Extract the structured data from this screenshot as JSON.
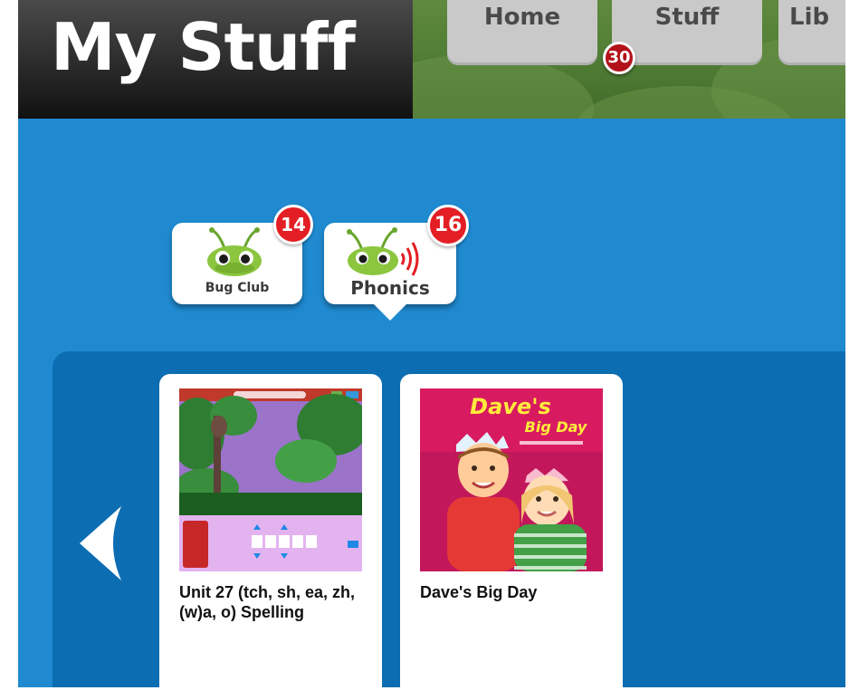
{
  "header": {
    "title": "My Stuff",
    "nav": [
      {
        "label": "Home"
      },
      {
        "label": "Stuff"
      },
      {
        "label": "Lib"
      }
    ],
    "stuff_badge": "30"
  },
  "categories": [
    {
      "label": "Bug Club",
      "badge": "14"
    },
    {
      "label": "Phonics",
      "badge": "16"
    }
  ],
  "items": [
    {
      "title": "Unit 27 (tch, sh, ea, zh, (w)a, o) Spelling"
    },
    {
      "title": "Dave's Big Day",
      "cover_title_line1": "Dave's",
      "cover_title_line2": "Big Day"
    }
  ],
  "colors": {
    "blue_background": "#1f8ad0",
    "panel_blue": "#0c6db3",
    "badge_red": "#e31e24",
    "bug_green": "#8cc63f"
  }
}
